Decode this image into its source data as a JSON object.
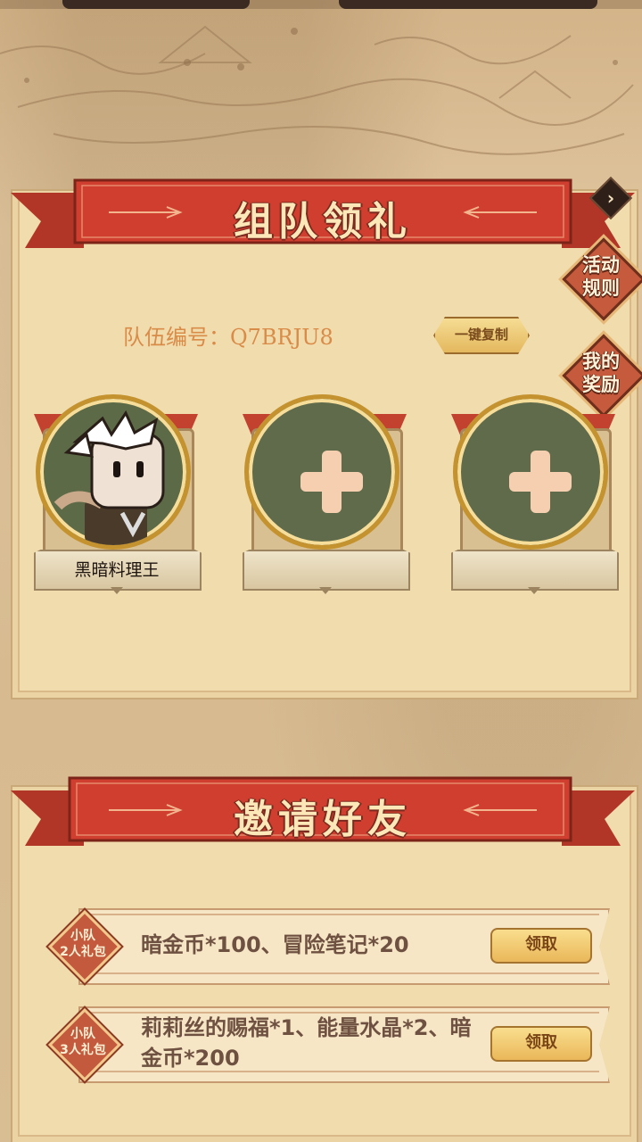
{
  "team_section": {
    "title": "组队领礼",
    "team_id_label": "队伍编号：Q7BRJU8",
    "copy_button": "一键复制",
    "members": [
      {
        "name": "黑暗料理王",
        "filled": true
      },
      {
        "name": "",
        "filled": false
      },
      {
        "name": "",
        "filled": false
      }
    ]
  },
  "side_buttons": {
    "rules": "活动\n规则",
    "rewards": "我的\n奖励"
  },
  "invite_section": {
    "title": "邀请好友",
    "rewards": [
      {
        "tier": "小队\n2人礼包",
        "description": "暗金币*100、冒险笔记*20",
        "button": "领取"
      },
      {
        "tier": "小队\n3人礼包",
        "description": "莉莉丝的赐福*1、能量水晶*2、暗金币*200",
        "button": "领取"
      }
    ]
  },
  "icons": [
    "chevron-right-icon",
    "plus-icon",
    "avatar-icon"
  ],
  "colors": {
    "ribbon_red": "#c83a2c",
    "panel": "#f1dcae",
    "accent_gold": "#e4b85e"
  }
}
